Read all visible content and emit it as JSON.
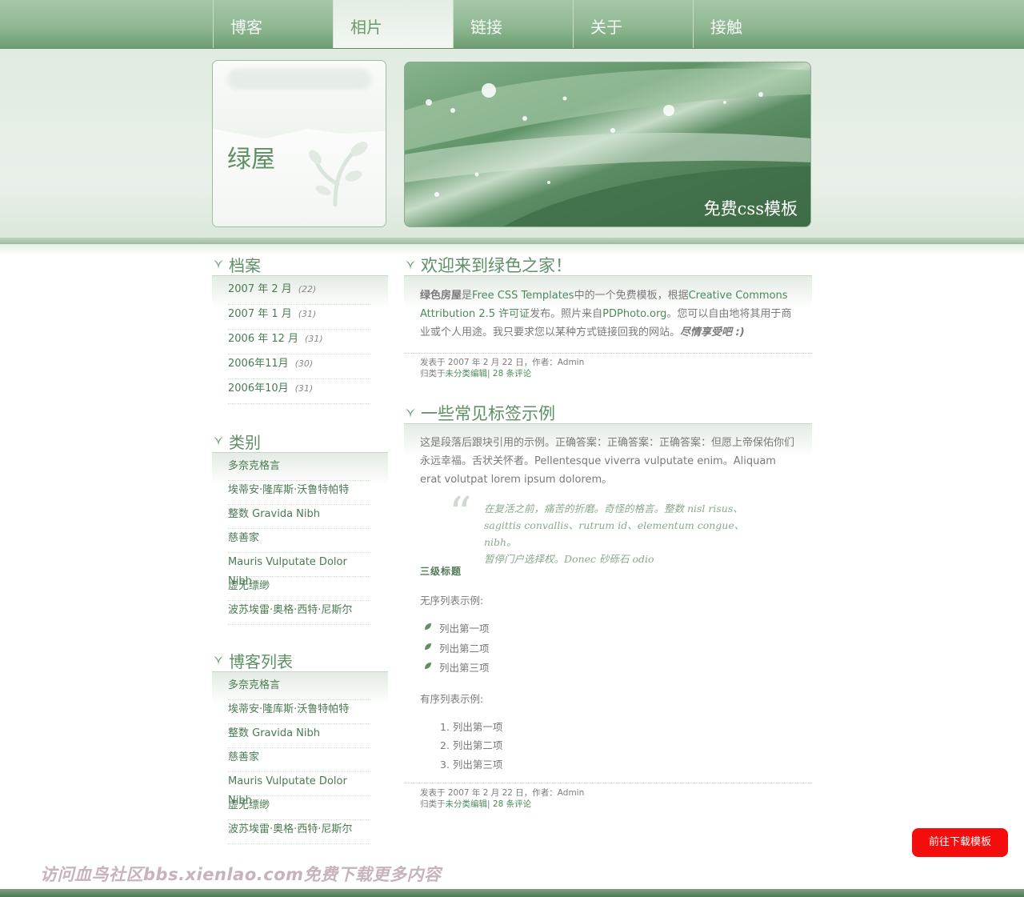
{
  "nav": {
    "items": [
      {
        "label": "博客"
      },
      {
        "label": "相片",
        "active": true
      },
      {
        "label": "链接"
      },
      {
        "label": "关于"
      },
      {
        "label": "接触"
      }
    ]
  },
  "header": {
    "site_title": "绿屋",
    "banner_text": "免费css模板"
  },
  "sidebar": {
    "archives": {
      "title": "档案",
      "items": [
        {
          "label": "2007 年 2 月",
          "count": "(22)"
        },
        {
          "label": "2007 年 1 月",
          "count": "(31)"
        },
        {
          "label": "2006 年 12 月",
          "count": "(31)"
        },
        {
          "label": "2006年11月",
          "count": "(30)"
        },
        {
          "label": "2006年10月",
          "count": "(31)"
        }
      ]
    },
    "categories": {
      "title": "类别",
      "items": [
        "多奈克格言",
        "埃蒂安·隆库斯·沃鲁特帕特",
        "整数 Gravida Nibh",
        "慈善家",
        "Mauris Vulputate Dolor Nibh",
        "虚无缥缈",
        "波苏埃雷·奥格·西特·尼斯尔"
      ]
    },
    "blogroll": {
      "title": "博客列表",
      "items": [
        "多奈克格言",
        "埃蒂安·隆库斯·沃鲁特帕特",
        "整数 Gravida Nibh",
        "慈善家",
        "Mauris Vulputate Dolor Nibh",
        "虚无缥缈",
        "波苏埃雷·奥格·西特·尼斯尔"
      ]
    }
  },
  "posts": [
    {
      "title": "欢迎来到绿色之家！",
      "body": {
        "strong": "绿色房屋",
        "t1": "是",
        "link1": "Free CSS Templates",
        "t2": "中的一个免费模板，根据",
        "link2": "Creative Commons Attribution 2.5 许可证",
        "t3": "发布。照片来自",
        "link3": "PDPhoto.org",
        "t4": "。您可以自由地将其用于商业或个人用途。我只要求您以某种方式链接回我的网站。",
        "emph": "尽情享受吧 :)"
      },
      "meta_line1": "发表于 2007 年 2 月 22 日，作者：Admin",
      "meta_prefix": "归类于",
      "meta_category": "未分类编辑",
      "meta_sep": "|",
      "meta_comments": "28 条评论"
    },
    {
      "title": "一些常见标签示例",
      "intro": "这是段落后跟块引用的示例。正确答案：正确答案：正确答案：但愿上帝保佑你们永远幸福。舌状关怀者。Pellentesque viverra vulputate enim。Aliquam erat volutpat lorem ipsum dolorem。",
      "quote_l1": "在复活之前，痛苦的折磨。奇怪的格言。整数 nisl risus、",
      "quote_l2": "sagittis convallis、rutrum id、elementum congue、nibh。",
      "quote_l3": "暂停门户选择权。Donec 砂砾石 odio",
      "h3": "三级标题",
      "ul_label": "无序列表示例:",
      "ul_items": [
        "列出第一项",
        "列出第二项",
        "列出第三项"
      ],
      "ol_label": "有序列表示例:",
      "ol_items": [
        "1. 列出第一项",
        "2. 列出第二项",
        "3. 列出第三项"
      ],
      "meta_line1": "发表于 2007 年 2 月 22 日，作者：Admin",
      "meta_prefix": "归类于",
      "meta_category": "未分类编辑",
      "meta_sep": "|",
      "meta_comments": "28 条评论"
    }
  ],
  "footer": {
    "watermark": "访问血鸟社区bbs.xienlao.com免费下载更多内容",
    "download_button": "前往下载模板"
  },
  "colors": {
    "accent_green": "#5e8f65",
    "nav_green": "#8fb892",
    "download_red": "#f50c0c"
  },
  "icons": [
    "leaf-icon",
    "quote-icon",
    "plant-deco-icon"
  ]
}
